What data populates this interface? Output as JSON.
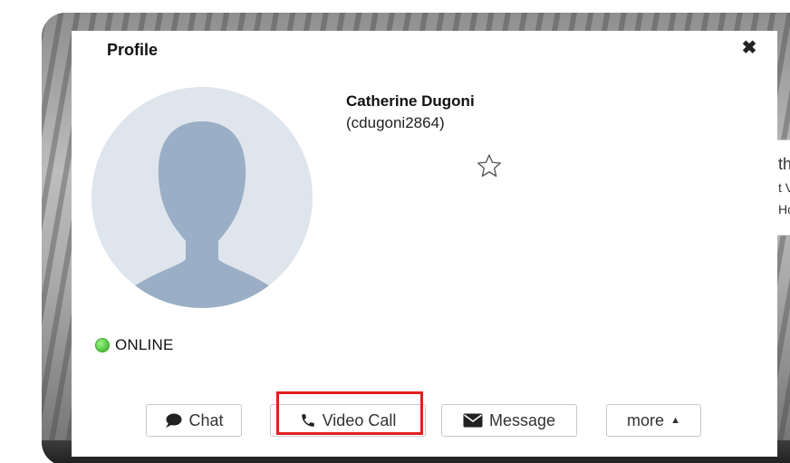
{
  "modal": {
    "title": "Profile",
    "close_glyph": "✖"
  },
  "profile": {
    "name": "Catherine Dugoni",
    "username": "(cdugoni2864)",
    "status": "ONLINE",
    "status_color": "#5cc94a",
    "favorite_icon": "star-outline-icon"
  },
  "actions": {
    "chat": {
      "label": "Chat",
      "icon": "speech-bubble-icon"
    },
    "video_call": {
      "label": "Video Call",
      "icon": "phone-icon"
    },
    "message": {
      "label": "Message",
      "icon": "envelope-icon"
    },
    "more": {
      "label": "more",
      "icon": "caret-up-icon",
      "caret": "▲"
    }
  },
  "background": {
    "side_card": {
      "line1": "th",
      "line2": "t V",
      "line3": "Hc"
    }
  },
  "colors": {
    "avatar_bg": "#dfe5ec",
    "avatar_silhouette": "#9aaec6",
    "highlight": "#e02020"
  }
}
